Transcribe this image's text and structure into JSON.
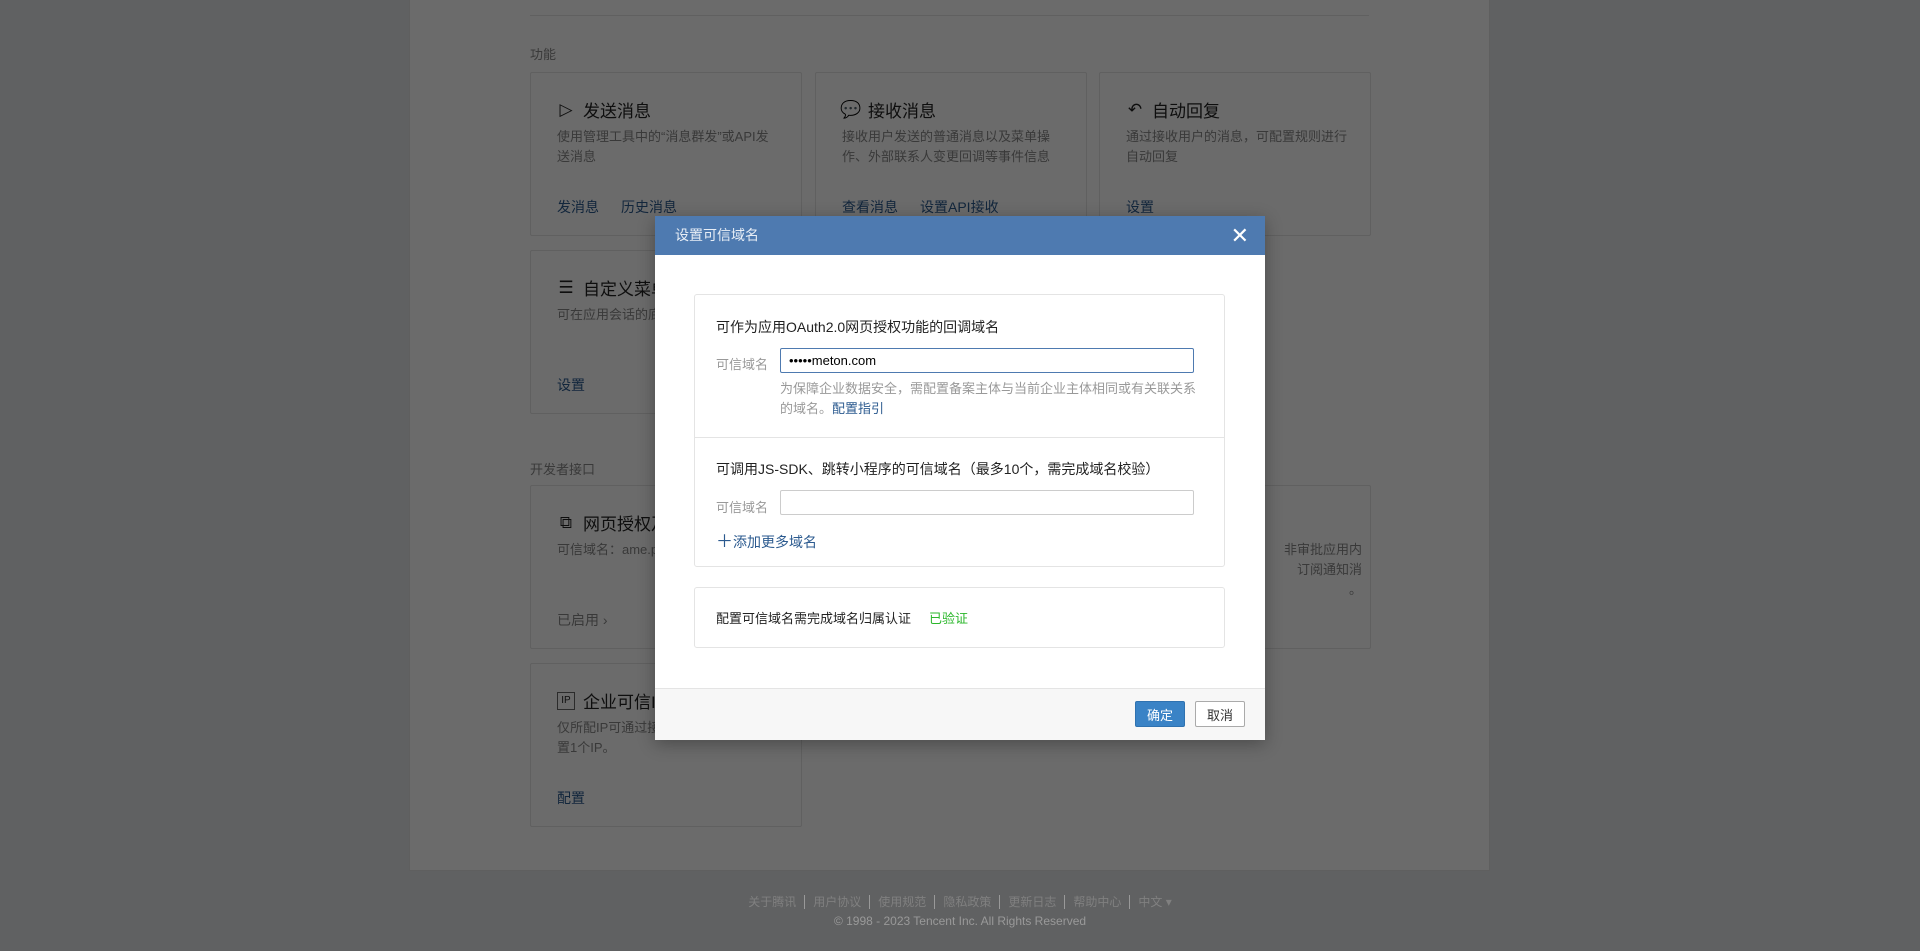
{
  "sections": {
    "features": "功能",
    "developer": "开发者接口"
  },
  "cards": [
    {
      "title": "发送消息",
      "icon": "send-icon",
      "desc": "使用管理工具中的“消息群发”或API发送消息",
      "links": [
        "发消息",
        "历史消息"
      ]
    },
    {
      "title": "接收消息",
      "icon": "message-icon",
      "desc": "接收用户发送的普通消息以及菜单操作、外部联系人变更回调等事件信息",
      "links": [
        "查看消息",
        "设置API接收"
      ]
    },
    {
      "title": "自动回复",
      "icon": "reply-icon",
      "desc": "通过接收用户的消息，可配置规则进行自动回复",
      "links": [
        "设置"
      ]
    },
    {
      "title": "自定义菜单",
      "icon": "menu-icon",
      "desc": "可在应用会话的底部",
      "links": [
        "设置"
      ]
    },
    {
      "title": "网页授权及",
      "icon": "copy-icon",
      "desc": "可信域名：ame.pr",
      "links": [
        "已启用 ›"
      ]
    },
    {
      "title": "",
      "icon": "",
      "desc": "非审批应用内\n订阅通知消\n。",
      "links": []
    },
    {
      "title": "企业可信IP",
      "icon": "ip-icon",
      "desc": "仅所配IP可通过接口\n置1个IP。",
      "links": [
        "配置"
      ]
    }
  ],
  "footer": {
    "links": [
      "关于腾讯",
      "用户协议",
      "使用规范",
      "隐私政策",
      "更新日志",
      "帮助中心",
      "中文 ▾"
    ],
    "copyright": "© 1998 - 2023 Tencent Inc. All Rights Reserved"
  },
  "modal": {
    "title": "设置可信域名",
    "oauth": {
      "title": "可作为应用OAuth2.0网页授权功能的回调域名",
      "label": "可信域名",
      "value": "•••••meton.com",
      "help": "为保障企业数据安全，需配置备案主体与当前企业主体相同或有关联关系的域名。",
      "help_link": "配置指引"
    },
    "jssdk": {
      "title": "可调用JS-SDK、跳转小程序的可信域名（最多10个，需完成域名校验）",
      "label": "可信域名",
      "value": "",
      "add_more": "添加更多域名"
    },
    "verify": {
      "text": "配置可信域名需完成域名归属认证",
      "status": "已验证",
      "status_color": "#2bb72b"
    },
    "confirm": "确定",
    "cancel": "取消"
  }
}
